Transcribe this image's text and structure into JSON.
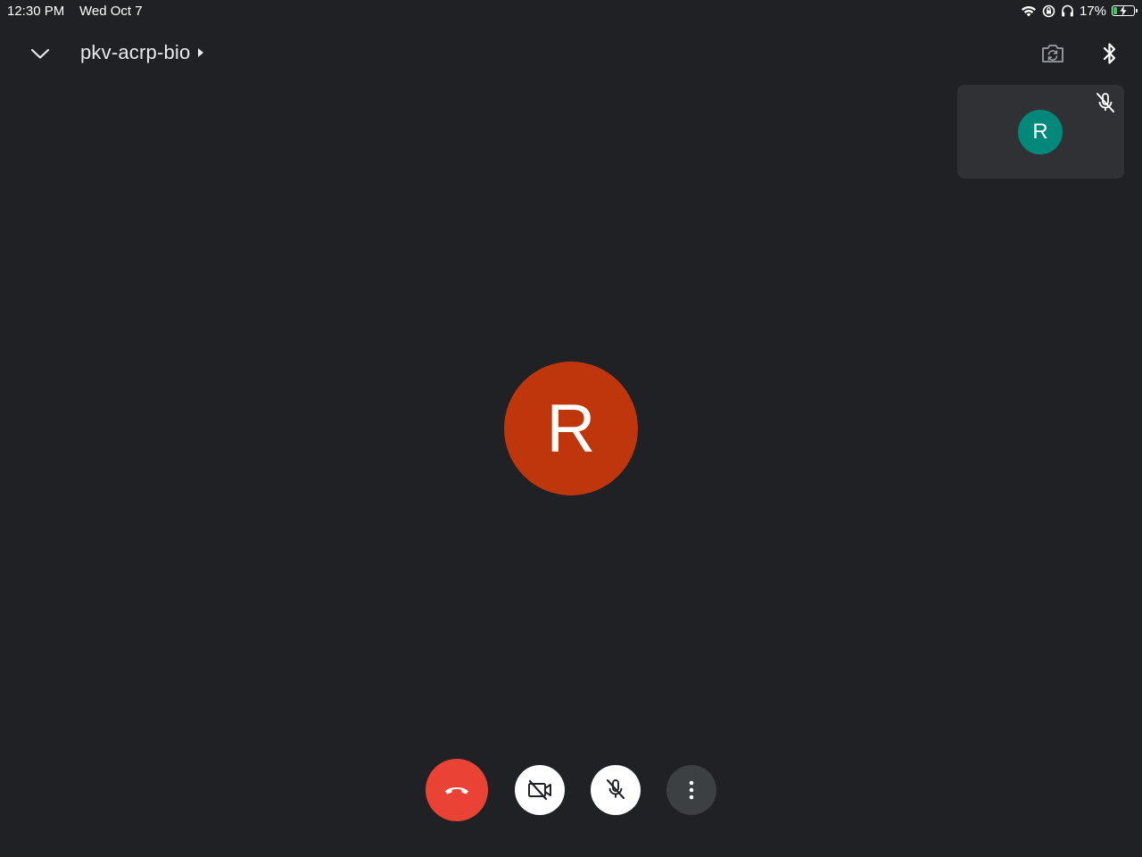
{
  "status_bar": {
    "time": "12:30 PM",
    "date": "Wed Oct 7",
    "battery_percent": "17%",
    "battery_level": 0.17,
    "icons": [
      "wifi-icon",
      "orientation-lock-icon",
      "headphones-icon",
      "battery-charging-icon"
    ]
  },
  "header": {
    "meeting_code": "pkv-acrp-bio",
    "collapse_icon": "chevron-down-icon",
    "title_icon": "caret-right-icon",
    "switch_camera_icon": "switch-camera-icon",
    "audio_output_icon": "bluetooth-icon"
  },
  "self_tile": {
    "initial": "R",
    "avatar_color": "#00897b",
    "muted_icon": "mic-off-icon"
  },
  "main_participant": {
    "initial": "R",
    "avatar_color": "#bf360c"
  },
  "controls": {
    "end_call_icon": "call-end-icon",
    "end_call_color": "#ea4335",
    "camera_icon": "videocam-off-icon",
    "mic_icon": "mic-off-icon",
    "more_icon": "more-vert-icon"
  },
  "colors": {
    "background": "#202124",
    "tile": "#303134"
  }
}
